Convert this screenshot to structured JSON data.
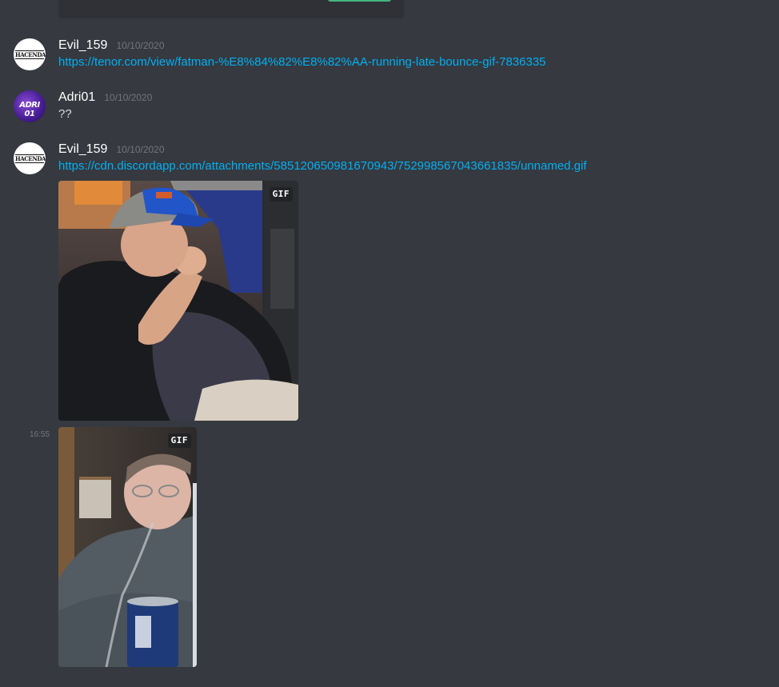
{
  "messages": [
    {
      "username": "Evil_159",
      "timestamp": "10/10/2020",
      "link": "https://tenor.com/view/fatman-%E8%84%82%E8%82%AA-running-late-bounce-gif-7836335",
      "avatar_text": "HACENDADO"
    },
    {
      "username": "Adri01",
      "timestamp": "10/10/2020",
      "text": "??",
      "avatar_text": "ADRI 01"
    },
    {
      "username": "Evil_159",
      "timestamp": "10/10/2020",
      "link": "https://cdn.discordapp.com/attachments/585120650981670943/752998567043661835/unnamed.gif",
      "avatar_text": "HACENDADO",
      "gif_badge": "GIF"
    },
    {
      "side_time": "16:55",
      "gif_badge": "GIF"
    }
  ],
  "icons": [
    "gif-badge",
    "avatar-hacendado",
    "avatar-adri01"
  ],
  "colors": {
    "background": "#36393f",
    "link": "#00b0f4",
    "username": "#ffffff",
    "timestamp": "#72767d",
    "embed": "#2f3136",
    "green_button": "#43b581"
  }
}
